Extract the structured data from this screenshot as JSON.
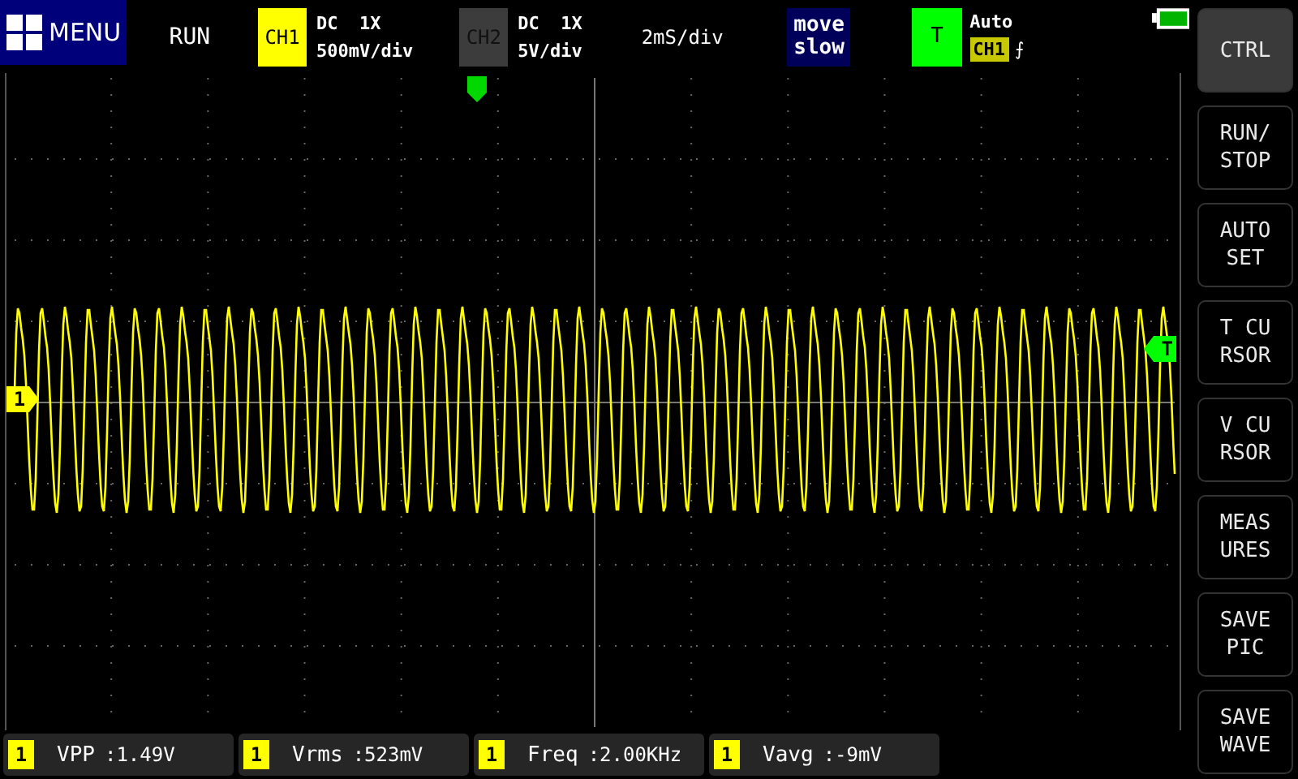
{
  "menu": {
    "label": "MENU"
  },
  "run_state": "RUN",
  "channels": [
    {
      "label": "CH1",
      "on": true,
      "coupling": "DC  1X",
      "scale": "500mV/div"
    },
    {
      "label": "CH2",
      "on": false,
      "coupling": "DC  1X",
      "scale": "5V/div"
    }
  ],
  "timebase": "2mS/div",
  "move_mode": {
    "line_1": "move",
    "line_2": "slow"
  },
  "trigger": {
    "label": "T",
    "mode": "Auto",
    "source": "CH1",
    "edge": "⨍"
  },
  "plot": {
    "channel_marker": "1",
    "trigger_marker": "T"
  },
  "measurements": [
    {
      "channel": "1",
      "label": "VPP",
      "value": ":1.49V"
    },
    {
      "channel": "1",
      "label": "Vrms",
      "value": ":523mV"
    },
    {
      "channel": "1",
      "label": "Freq",
      "value": ":2.00KHz"
    },
    {
      "channel": "1",
      "label": "Vavg",
      "value": ":-9mV"
    }
  ],
  "buttons": [
    {
      "label": "CTRL",
      "selected": true
    },
    {
      "label": "RUN/\nSTOP",
      "selected": false
    },
    {
      "label": "AUTO\nSET",
      "selected": false
    },
    {
      "label": "T CU\nRSOR",
      "selected": false
    },
    {
      "label": "V CU\nRSOR",
      "selected": false
    },
    {
      "label": "MEAS\nURES",
      "selected": false
    },
    {
      "label": "SAVE\nPIC",
      "selected": false
    },
    {
      "label": "SAVE\nWAVE",
      "selected": false
    }
  ]
}
